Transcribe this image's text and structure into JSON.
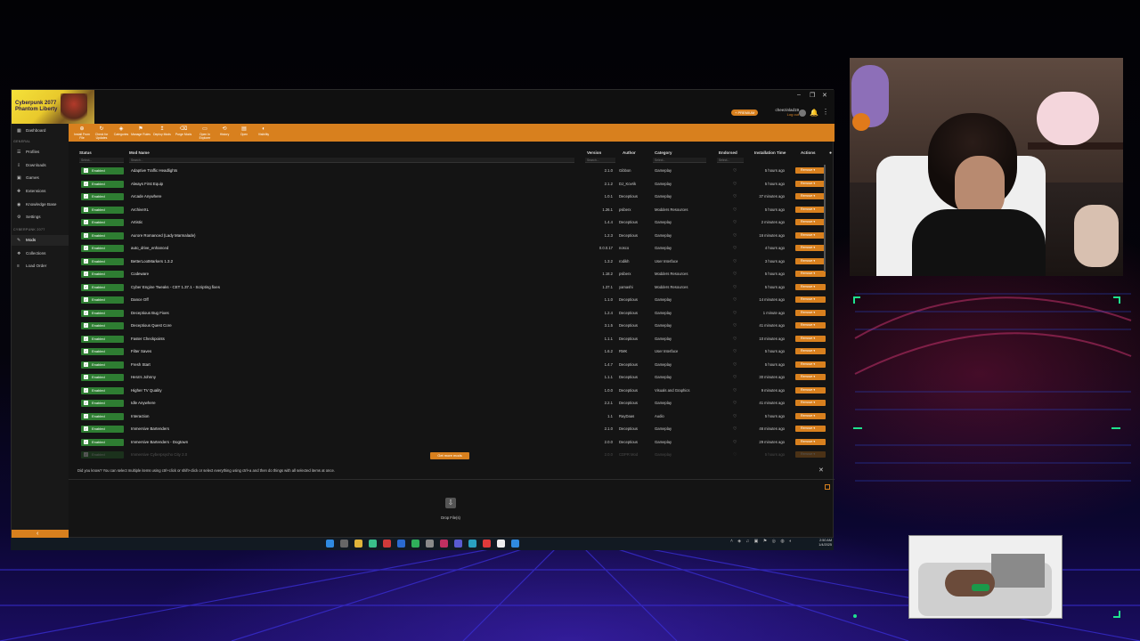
{
  "window": {
    "game_title_line1": "Cyberpunk 2077",
    "game_title_line2": "Phantom Liberty",
    "premium_badge": "+ PREMIUM",
    "username": "cheezinlad19",
    "logout": "Log out"
  },
  "sidebar": {
    "dashboard": "Dashboard",
    "general_heading": "GENERAL",
    "general_items": [
      "Profiles",
      "Downloads",
      "Games",
      "Extensions",
      "Knowledge Base",
      "Settings"
    ],
    "game_heading": "CYBERPUNK 2077",
    "game_items": [
      "Mods",
      "Collections",
      "Load Order"
    ]
  },
  "toolbar": {
    "buttons": [
      "Install From File",
      "Check for Updates",
      "Categories",
      "Manage Rules",
      "Deploy Mods",
      "Purge Mods",
      "Open In Explorer",
      "History",
      "Open",
      "Visibility"
    ]
  },
  "table": {
    "headers": {
      "status": "Status",
      "mod_name": "Mod Name",
      "version": "Version",
      "author": "Author",
      "category": "Category",
      "endorsed": "Endorsed",
      "install_time": "Installation Time",
      "actions": "Actions"
    },
    "filter_placeholder": "Search...",
    "select_placeholder": "Select...",
    "status_label": "Enabled",
    "remove_label": "Remove",
    "rows": [
      {
        "name": "Adaptive Traffic Headlights",
        "version": "2.1.0",
        "author": "Gibbon",
        "category": "Gameplay",
        "time": "5 hours ago"
      },
      {
        "name": "Always First Equip",
        "version": "2.1.2",
        "author": "DJ_Kovrik",
        "category": "Gameplay",
        "time": "5 hours ago"
      },
      {
        "name": "Arcade Anywhere",
        "version": "1.0.1",
        "author": "Deceptious",
        "category": "Gameplay",
        "time": "37 minutes ago"
      },
      {
        "name": "ArchiveXL",
        "version": "1.26.1",
        "author": "psiberx",
        "category": "Modders Resources",
        "time": "5 hours ago"
      },
      {
        "name": "Artistic",
        "version": "1.4.4",
        "author": "Deceptious",
        "category": "Gameplay",
        "time": "2 minutes ago"
      },
      {
        "name": "Aurore Romanced (Lady Marmalade)",
        "version": "1.2.3",
        "author": "Deceptious",
        "category": "Gameplay",
        "time": "16 minutes ago"
      },
      {
        "name": "auto_drive_enhanced",
        "version": "0.0.0.17",
        "author": "nosco",
        "category": "Gameplay",
        "time": "4 hours ago"
      },
      {
        "name": "BetterLootMarkers 1.3.2",
        "version": "1.3.2",
        "author": "rodikh",
        "category": "User Interface",
        "time": "3 hours ago"
      },
      {
        "name": "Codeware",
        "version": "1.18.2",
        "author": "psiberx",
        "category": "Modders Resources",
        "time": "5 hours ago"
      },
      {
        "name": "Cyber Engine Tweaks - CET 1.37.1 - Scripting fixes",
        "version": "1.37.1",
        "author": "yamashi",
        "category": "Modders Resources",
        "time": "5 hours ago"
      },
      {
        "name": "Dance Off",
        "version": "1.1.0",
        "author": "Deceptious",
        "category": "Gameplay",
        "time": "14 minutes ago"
      },
      {
        "name": "Deceptious Bug Fixes",
        "version": "1.2.4",
        "author": "Deceptious",
        "category": "Gameplay",
        "time": "1 minute ago"
      },
      {
        "name": "Deceptious Quest Core",
        "version": "3.1.5",
        "author": "Deceptious",
        "category": "Gameplay",
        "time": "41 minutes ago"
      },
      {
        "name": "Faster Checkpoints",
        "version": "1.1.1",
        "author": "Deceptious",
        "category": "Gameplay",
        "time": "10 minutes ago"
      },
      {
        "name": "Filter Saves",
        "version": "1.6.2",
        "author": "RMK",
        "category": "User Interface",
        "time": "5 hours ago"
      },
      {
        "name": "Fresh Start",
        "version": "1.4.7",
        "author": "Deceptious",
        "category": "Gameplay",
        "time": "5 hours ago"
      },
      {
        "name": "Hera's Johnny",
        "version": "1.1.1",
        "author": "Deceptious",
        "category": "Gameplay",
        "time": "30 minutes ago"
      },
      {
        "name": "Higher TV Quality",
        "version": "1.0.0",
        "author": "Deceptious",
        "category": "Visuals and Graphics",
        "time": "9 minutes ago"
      },
      {
        "name": "Idle Anywhere",
        "version": "2.2.1",
        "author": "Deceptious",
        "category": "Gameplay",
        "time": "41 minutes ago"
      },
      {
        "name": "Interaction",
        "version": "1.1",
        "author": "RayDaas",
        "category": "Audio",
        "time": "5 hours ago"
      },
      {
        "name": "Immersive Bartenders",
        "version": "2.1.0",
        "author": "Deceptious",
        "category": "Gameplay",
        "time": "46 minutes ago"
      },
      {
        "name": "Immersive Bartenders - Dogtown",
        "version": "2.0.0",
        "author": "Deceptious",
        "category": "Gameplay",
        "time": "29 minutes ago"
      },
      {
        "name": "Immersive Cyberpsycho City 2.0",
        "version": "2.0.0",
        "author": "CDPR Mod",
        "category": "Gameplay",
        "time": "5 hours ago"
      }
    ],
    "get_more": "Get more mods"
  },
  "tip": "Did you know? You can select multiple items using ctrl+click or shift+click or select everything using ctrl+a and then do things with all selected items at once.",
  "dropzone": "Drop File(s)",
  "taskbar": {
    "time": "2:50 AM",
    "date": "1/4/2025"
  },
  "colors": {
    "accent": "#d8801e",
    "enabled": "#2e7d32",
    "neon": "#1fe28e"
  }
}
